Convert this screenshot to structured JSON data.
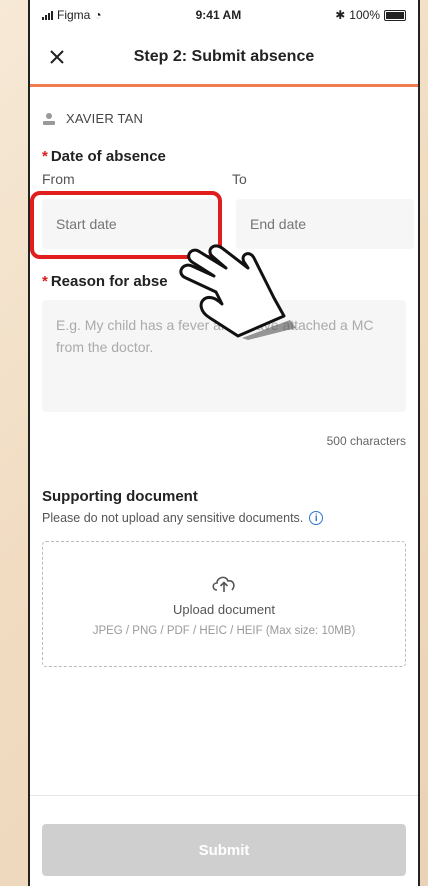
{
  "status_bar": {
    "carrier": "Figma",
    "time": "9:41 AM",
    "battery": "100%"
  },
  "header": {
    "title": "Step 2: Submit absence",
    "close_icon": "close-icon",
    "accent_color": "#f07c4f"
  },
  "user": {
    "name": "XAVIER TAN",
    "icon": "person-icon"
  },
  "date_section": {
    "label": "Date of absence",
    "required_mark": "*",
    "from_label": "From",
    "to_label": "To",
    "start_placeholder": "Start date",
    "end_placeholder": "End date"
  },
  "reason_section": {
    "label": "Reason for abse",
    "required_mark": "*",
    "placeholder": "E.g. My child has a fever and I have attached a MC from the doctor.",
    "char_count": "500 characters"
  },
  "supporting": {
    "title": "Supporting document",
    "subtitle": "Please do not upload any sensitive documents.",
    "info_icon": "info-icon",
    "upload_label": "Upload document",
    "upload_icon": "cloud-upload-icon",
    "formats": "JPEG / PNG / PDF / HEIC / HEIF (Max size: 10MB)"
  },
  "footer": {
    "submit_label": "Submit"
  },
  "overlay": {
    "highlight_color": "#e01e1e",
    "pointer_icon": "hand-pointer-icon"
  }
}
